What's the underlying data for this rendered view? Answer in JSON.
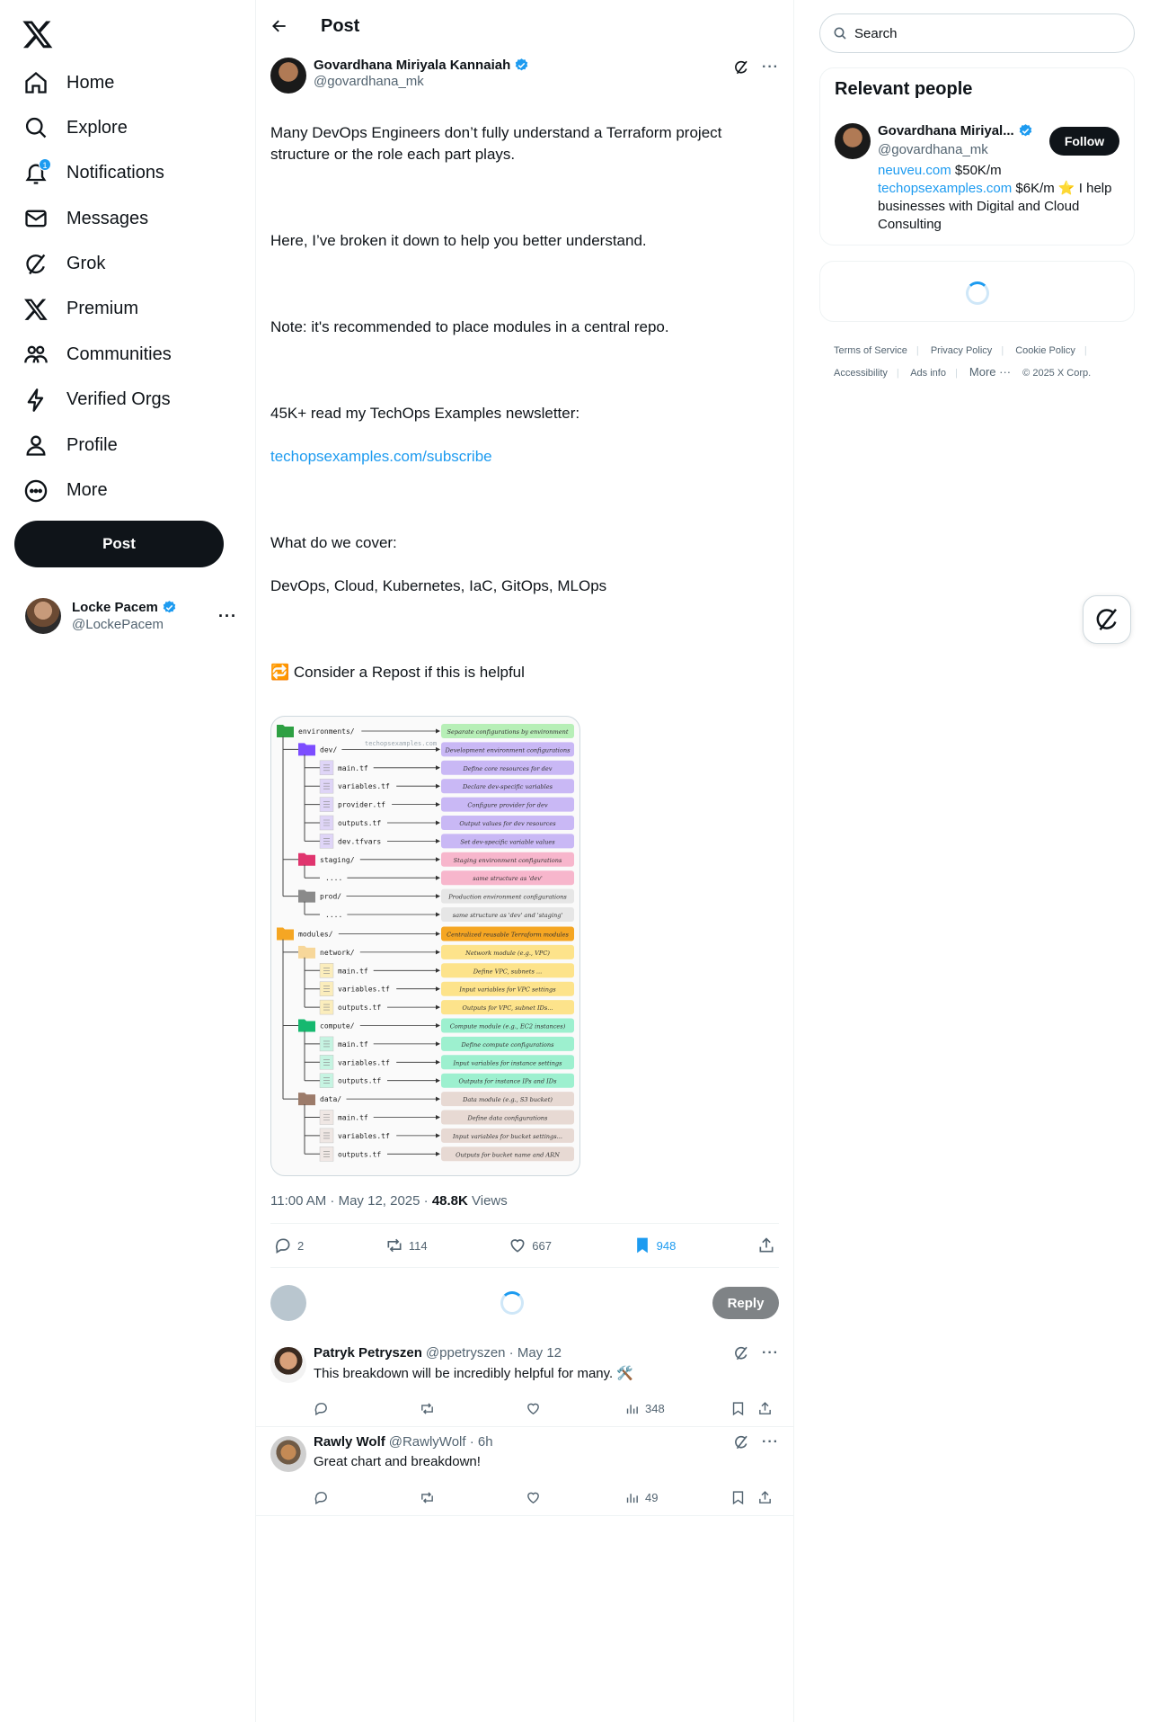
{
  "nav": {
    "items": [
      {
        "label": "Home",
        "icon": "home-icon"
      },
      {
        "label": "Explore",
        "icon": "search-icon"
      },
      {
        "label": "Notifications",
        "icon": "bell-icon",
        "badge": "1"
      },
      {
        "label": "Messages",
        "icon": "mail-icon"
      },
      {
        "label": "Grok",
        "icon": "grok-icon"
      },
      {
        "label": "Premium",
        "icon": "x-logo-icon"
      },
      {
        "label": "Communities",
        "icon": "communities-icon"
      },
      {
        "label": "Verified Orgs",
        "icon": "lightning-icon"
      },
      {
        "label": "Profile",
        "icon": "person-icon"
      },
      {
        "label": "More",
        "icon": "more-circle-icon"
      }
    ],
    "post_button": "Post"
  },
  "account": {
    "name": "Locke Pacem",
    "handle": "@LockePacem",
    "more": "···"
  },
  "header": {
    "title": "Post"
  },
  "post": {
    "author": {
      "name": "Govardhana Miriyala Kannaiah",
      "handle": "@govardhana_mk"
    },
    "more": "···",
    "paragraphs": [
      "Many DevOps Engineers don’t fully understand a Terraform project structure or the role each part plays.",
      "Here, I’ve broken it down to help you better understand.",
      "Note: it's recommended to place modules in a central repo.",
      "45K+ read my TechOps Examples newsletter:"
    ],
    "link": "techopsexamples.com/subscribe",
    "cover_title": "What do we cover:",
    "cover_list": "DevOps, Cloud, Kubernetes, IaC, GitOps, MLOps",
    "cta": "🔁 Consider a Repost if this is helpful",
    "timestamp": "11:00 AM · May 12, 2025 · ",
    "views_count": "48.8K",
    "views_label": " Views",
    "stats": {
      "replies": "2",
      "reposts": "114",
      "likes": "667",
      "bookmarks": "948"
    }
  },
  "image": {
    "watermark": "techopsexamples.com",
    "rows": [
      {
        "label": "environments/",
        "desc": "Separate configurations by environment",
        "color": "#b7efb7",
        "kind": "folder",
        "fcolor": "#2ea043",
        "depth": 0
      },
      {
        "label": "dev/",
        "desc": "Development environment configurations",
        "color": "#c9b8f5",
        "kind": "folder",
        "fcolor": "#7c4dff",
        "depth": 1
      },
      {
        "label": "main.tf",
        "desc": "Define core resources for dev",
        "color": "#c9b8f5",
        "kind": "file",
        "depth": 2
      },
      {
        "label": "variables.tf",
        "desc": "Declare dev-specific variables",
        "color": "#c9b8f5",
        "kind": "file",
        "depth": 2
      },
      {
        "label": "provider.tf",
        "desc": "Configure provider for dev",
        "color": "#c9b8f5",
        "kind": "file",
        "depth": 2
      },
      {
        "label": "outputs.tf",
        "desc": "Output values for dev resources",
        "color": "#c9b8f5",
        "kind": "file",
        "depth": 2
      },
      {
        "label": "dev.tfvars",
        "desc": "Set dev-specific variable values",
        "color": "#c9b8f5",
        "kind": "file",
        "depth": 2
      },
      {
        "label": "staging/",
        "desc": "Staging environment configurations",
        "color": "#f7b6cc",
        "kind": "folder",
        "fcolor": "#e0356e",
        "depth": 1
      },
      {
        "label": "....",
        "desc": "same structure as 'dev'",
        "color": "#f7b6cc",
        "kind": "dots",
        "depth": 2
      },
      {
        "label": "prod/",
        "desc": "Production environment configurations",
        "color": "#e6e6e6",
        "kind": "folder",
        "fcolor": "#8a8a8a",
        "depth": 1
      },
      {
        "label": "....",
        "desc": "same structure as 'dev' and 'staging'",
        "color": "#e6e6e6",
        "kind": "dots",
        "depth": 2
      },
      {
        "label": "modules/",
        "desc": "Centralized reusable Terraform modules",
        "color": "#f5a623",
        "kind": "folder",
        "fcolor": "#f5a623",
        "depth": 0
      },
      {
        "label": "network/",
        "desc": "Network module (e.g., VPC)",
        "color": "#fde38b",
        "kind": "folder",
        "fcolor": "#f7d79a",
        "depth": 1
      },
      {
        "label": "main.tf",
        "desc": "Define VPC, subnets ...",
        "color": "#fde38b",
        "kind": "file",
        "depth": 2
      },
      {
        "label": "variables.tf",
        "desc": "Input variables for VPC settings",
        "color": "#fde38b",
        "kind": "file",
        "depth": 2
      },
      {
        "label": "outputs.tf",
        "desc": "Outputs for VPC, subnet IDs...",
        "color": "#fde38b",
        "kind": "file",
        "depth": 2
      },
      {
        "label": "compute/",
        "desc": "Compute module (e.g., EC2 instances)",
        "color": "#9df0cf",
        "kind": "folder",
        "fcolor": "#16b86f",
        "depth": 1
      },
      {
        "label": "main.tf",
        "desc": "Define compute configurations",
        "color": "#9df0cf",
        "kind": "file",
        "depth": 2
      },
      {
        "label": "variables.tf",
        "desc": "Input variables for instance settings",
        "color": "#9df0cf",
        "kind": "file",
        "depth": 2
      },
      {
        "label": "outputs.tf",
        "desc": "Outputs for instance IPs and IDs",
        "color": "#9df0cf",
        "kind": "file",
        "depth": 2
      },
      {
        "label": "data/",
        "desc": "Data module (e.g., S3 bucket)",
        "color": "#e7d9d3",
        "kind": "folder",
        "fcolor": "#9c7b6a",
        "depth": 1
      },
      {
        "label": "main.tf",
        "desc": "Define data configurations",
        "color": "#e7d9d3",
        "kind": "file",
        "depth": 2
      },
      {
        "label": "variables.tf",
        "desc": "Input variables for bucket settings...",
        "color": "#e7d9d3",
        "kind": "file",
        "depth": 2
      },
      {
        "label": "outputs.tf",
        "desc": "Outputs for bucket name and ARN",
        "color": "#e7d9d3",
        "kind": "file",
        "depth": 2
      }
    ]
  },
  "reply_box": {
    "button": "Reply"
  },
  "replies": [
    {
      "name": "Patryk Petryszen",
      "meta": "@ppetryszen · May 12",
      "text": "This breakdown will be incredibly helpful for many. 🛠️",
      "views": "348"
    },
    {
      "name": "Rawly Wolf",
      "meta": "@RawlyWolf · 6h",
      "text": "Great chart and breakdown!",
      "views": "49"
    }
  ],
  "search": {
    "placeholder": "Search"
  },
  "relevant": {
    "title": "Relevant people",
    "name": "Govardhana Miriyal...",
    "handle": "@govardhana_mk",
    "follow": "Follow",
    "bio_link1": "neuveu.com",
    "bio_text1": " $50K/m",
    "bio_link2": "techopsexamples.com",
    "bio_text2": " $6K/m ⭐ I help businesses with Digital and Cloud Consulting"
  },
  "footer": {
    "terms": "Terms of Service",
    "privacy": "Privacy Policy",
    "cookie": "Cookie Policy",
    "accessibility": "Accessibility",
    "ads": "Ads info",
    "more": "More ···",
    "copyright": "© 2025 X Corp."
  },
  "colors": {
    "accent": "#1d9bf0",
    "text": "#0f1419",
    "muted": "#536471"
  }
}
